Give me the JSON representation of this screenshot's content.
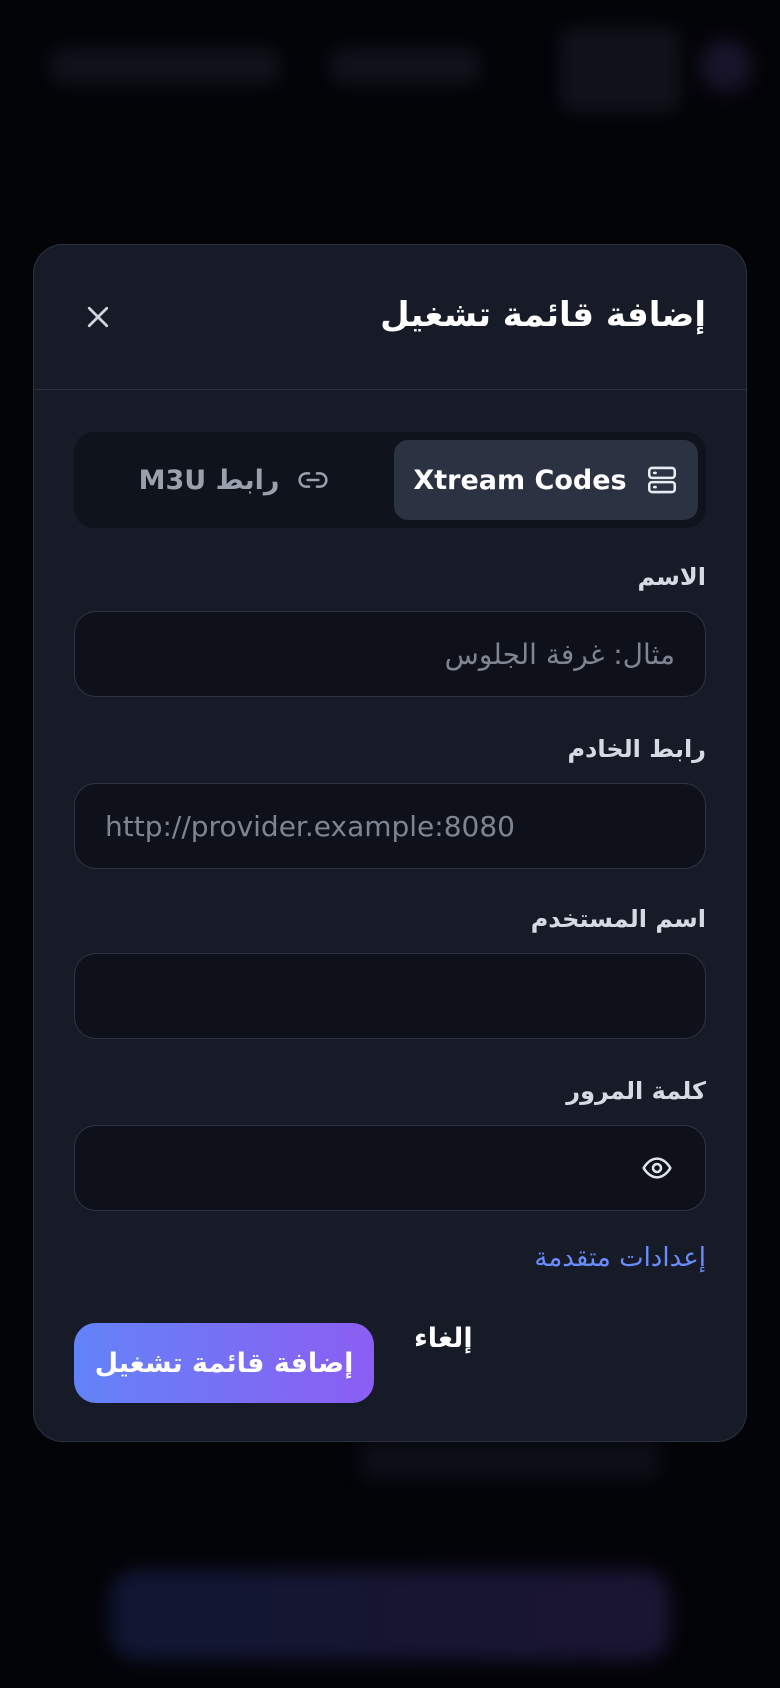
{
  "modal": {
    "title": "إضافة قائمة تشغيل",
    "close_icon": "close-icon"
  },
  "tabs": [
    {
      "label": "Xtream Codes",
      "icon": "server-icon",
      "active": true
    },
    {
      "label": "رابط M3U",
      "icon": "link-icon",
      "active": false
    }
  ],
  "fields": {
    "name": {
      "label": "الاسم",
      "placeholder": "مثال: غرفة الجلوس",
      "value": ""
    },
    "server_url": {
      "label": "رابط الخادم",
      "placeholder": "http://provider.example:8080",
      "value": ""
    },
    "username": {
      "label": "اسم المستخدم",
      "placeholder": "",
      "value": ""
    },
    "password": {
      "label": "كلمة المرور",
      "placeholder": "",
      "value": "",
      "toggle_icon": "eye-icon"
    }
  },
  "advanced_link": "إعدادات متقدمة",
  "actions": {
    "cancel": "إلغاء",
    "submit": "إضافة قائمة تشغيل"
  },
  "colors": {
    "accent_link": "#6a8cff",
    "button_gradient_start": "#6383f7",
    "button_gradient_end": "#8b5ef3",
    "modal_bg": "#161b27"
  }
}
